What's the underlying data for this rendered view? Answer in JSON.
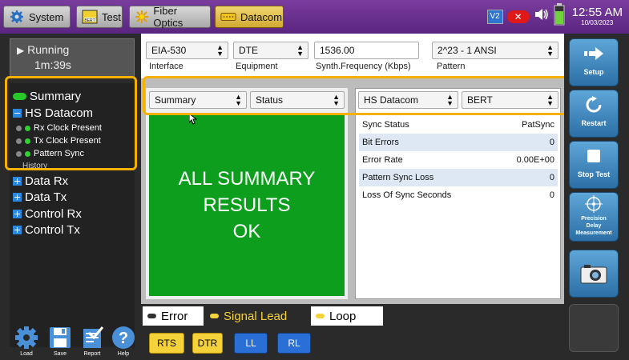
{
  "topbar": {
    "tabs": [
      {
        "label": "System",
        "icon": "gear-icon"
      },
      {
        "label": "Test",
        "icon": "bert-icon",
        "icon_text": "BERT"
      },
      {
        "label": "Fiber Optics",
        "icon": "starburst-icon"
      },
      {
        "label": "Datacom",
        "icon": "connector-icon"
      }
    ],
    "status": {
      "v_label": "V2",
      "time": "12:55 AM",
      "date": "10/03/2023"
    }
  },
  "run": {
    "state": "Running",
    "elapsed": "1m:39s"
  },
  "tree": {
    "summary": "Summary",
    "hs_datacom": "HS Datacom",
    "rx_clock": "Rx Clock Present",
    "tx_clock": "Tx Clock Present",
    "pattern_sync": "Pattern Sync",
    "history": "History",
    "data_rx": "Data Rx",
    "data_tx": "Data Tx",
    "control_rx": "Control Rx",
    "control_tx": "Control Tx"
  },
  "tools": {
    "load": "Load",
    "save": "Save",
    "report": "Report",
    "help": "Help"
  },
  "config": {
    "interface_value": "EIA-530",
    "interface_label": "Interface",
    "equipment_value": "DTE",
    "equipment_label": "Equipment",
    "freq_value": "1536.00",
    "freq_label": "Synth.Frequency (Kbps)",
    "pattern_value": "2^23 - 1 ANSI",
    "pattern_label": "Pattern"
  },
  "left_panel": {
    "group": "Summary",
    "view": "Status",
    "message_lines": [
      "ALL SUMMARY",
      "RESULTS",
      "OK"
    ]
  },
  "right_panel": {
    "group": "HS Datacom",
    "view": "BERT",
    "rows": [
      {
        "key": "Sync Status",
        "value": "PatSync"
      },
      {
        "key": "Bit Errors",
        "value": "0"
      },
      {
        "key": "Error Rate",
        "value": "0.00E+00"
      },
      {
        "key": "Pattern Sync Loss",
        "value": "0"
      },
      {
        "key": "Loss Of Sync Seconds",
        "value": "0"
      }
    ]
  },
  "legend": {
    "error": "Error",
    "signal_lead": "Signal Lead",
    "loop": "Loop"
  },
  "signals": {
    "rts": "RTS",
    "dtr": "DTR",
    "ll": "LL",
    "rl": "RL"
  },
  "actions": {
    "setup": "Setup",
    "restart": "Restart",
    "stop": "Stop Test",
    "precision_lines": [
      "Precision",
      "Delay",
      "Measurement"
    ]
  },
  "colors": {
    "accent_yellow": "#f5b000",
    "ok_green": "#0c9e1c",
    "action_blue": "#2b6fa6"
  }
}
